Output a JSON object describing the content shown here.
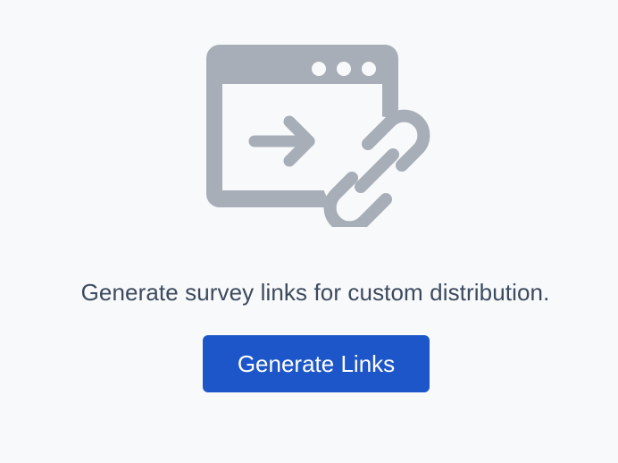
{
  "empty_state": {
    "illustration_icon": "browser-window-with-arrow-and-link-icon",
    "message": "Generate survey links for custom distribution.",
    "button_label": "Generate Links"
  },
  "colors": {
    "background": "#f8f9fb",
    "illustration": "#a7aeb8",
    "message_text": "#3c4a5e",
    "button": "#1d56c8",
    "button_text": "#ffffff"
  }
}
